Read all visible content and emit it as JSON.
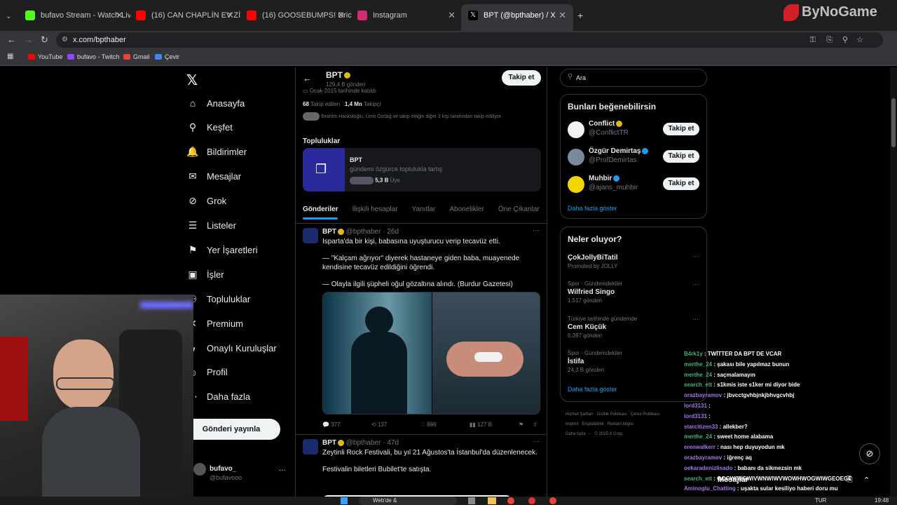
{
  "browser": {
    "tabs": [
      {
        "label": "bufavo Stream - Watch Live on",
        "color": "#53fc18"
      },
      {
        "label": "(16) CAN CHAPLİN EV ZİYARETİ",
        "color": "#ff0000"
      },
      {
        "label": "(16) GOOSEBUMPS! Dricus Du",
        "color": "#ff0000"
      },
      {
        "label": "Instagram",
        "color": "#d62976"
      },
      {
        "label": "BPT (@bpthaber) / X",
        "color": "#ffffff"
      }
    ],
    "url": "x.com/bpthaber",
    "bookmarks": [
      {
        "label": "YouTube",
        "color": "#ff0000"
      },
      {
        "label": "bufavo - Twitch",
        "color": "#9146ff"
      },
      {
        "label": "Gmail",
        "color": "#ea4335"
      },
      {
        "label": "Çevir",
        "color": "#4285f4"
      }
    ],
    "watermark": "ByNoGame"
  },
  "nav": {
    "items": [
      {
        "label": "Anasayfa",
        "icon": "home-icon",
        "glyph": "⌂"
      },
      {
        "label": "Keşfet",
        "icon": "search-icon",
        "glyph": "⚲"
      },
      {
        "label": "Bildirimler",
        "icon": "bell-icon",
        "glyph": "🔔"
      },
      {
        "label": "Mesajlar",
        "icon": "mail-icon",
        "glyph": "✉"
      },
      {
        "label": "Grok",
        "icon": "grok-icon",
        "glyph": "⊘"
      },
      {
        "label": "Listeler",
        "icon": "list-icon",
        "glyph": "☰"
      },
      {
        "label": "Yer İşaretleri",
        "icon": "bookmark-icon",
        "glyph": "⚑"
      },
      {
        "label": "İşler",
        "icon": "briefcase-icon",
        "glyph": "▣"
      },
      {
        "label": "Topluluklar",
        "icon": "people-icon",
        "glyph": "⚇"
      },
      {
        "label": "Premium",
        "icon": "x-logo-icon",
        "glyph": "✕"
      },
      {
        "label": "Onaylı Kuruluşlar",
        "icon": "lightning-icon",
        "glyph": "ϟ"
      },
      {
        "label": "Profil",
        "icon": "person-icon",
        "glyph": "☺"
      },
      {
        "label": "Daha fazla",
        "icon": "more-circle-icon",
        "glyph": "⋯"
      }
    ],
    "post_button": "Gönderi yayınla",
    "account_name": "bufavo_",
    "account_handle": "@bufavooo"
  },
  "profile": {
    "name": "BPT",
    "post_count": "129,4 B gönderi",
    "follow_label": "Takip et",
    "joined": "Ocak 2015 tarihinde katıldı",
    "following_count": "68",
    "following_label": "Takip edilen",
    "followers_count": "1,4 Mn",
    "followers_label": "Takipçi",
    "followed_by": "İbrahim Haskoloğlu, Ümit Özdağ ve takip ettiğin diğer 3 kişi tarafından takip ediliyor",
    "communities_title": "Topluluklar",
    "community": {
      "name": "BPT",
      "desc": "gündemi özgürce toplulukla tartış",
      "members": "5,3 B",
      "members_label": "Üye"
    },
    "tabs": [
      "Gönderiler",
      "İlişkili hesaplar",
      "Yanıtlar",
      "Abonelikler",
      "Öne Çıkanlar",
      "M"
    ]
  },
  "tweets": [
    {
      "name": "BPT",
      "handle": "@bpthaber",
      "time": "26d",
      "lines": [
        "Isparta'da bir kişi, babasına uyuşturucu verip tecavüz etti.",
        "— \"Kalçam ağrıyor\" diyerek hastaneye giden baba, muayenede kendisine tecavüz edildiğini öğrendi.",
        "— Olayla ilgili şüpheli oğul gözaltına alındı. (Burdur Gazetesi)"
      ],
      "replies": "377",
      "retweets": "137",
      "likes": "886",
      "views": "127 B"
    },
    {
      "name": "BPT",
      "handle": "@bpthaber",
      "time": "47d",
      "lines": [
        "Zeytinli Rock Festivali, bu yıl 21 Ağustos'ta İstanbul'da düzenlenecek.",
        "Festivalin biletleri Bubilet'te satışta."
      ]
    }
  ],
  "right": {
    "search_placeholder": "Ara",
    "suggest_title": "Bunları beğenebilirsin",
    "suggestions": [
      {
        "name": "Conflict",
        "handle": "@ConflictTR",
        "color": "#f2f2f2"
      },
      {
        "name": "Özgür Demirtaş",
        "handle": "@ProfDemirtas",
        "color": "#7a8a9a"
      },
      {
        "name": "Muhbir",
        "handle": "@ajans_muhbir",
        "color": "#f2d600"
      }
    ],
    "follow_label": "Takip et",
    "show_more": "Daha fazla göster",
    "trends_title": "Neler oluyor?",
    "trends": [
      {
        "context": "",
        "name": "ÇokJollyBiTatil",
        "meta": "Promoted by JOLLY"
      },
      {
        "context": "Spor · Gündemdekiler",
        "name": "Wilfried Singo",
        "meta": "1.517 gönderi"
      },
      {
        "context": "Türkiye tarihinde gündemde",
        "name": "Cem Küçük",
        "meta": "6.397 gönderi"
      },
      {
        "context": "Spor · Gündemdekiler",
        "name": "İstifa",
        "meta": "24,3 B gönderi"
      }
    ],
    "footer": [
      "Hizmet Şartları",
      "Gizlilik Politikası",
      "Çerez Politikası",
      "Imprint",
      "Erişilebilirlik",
      "Reklam bilgisi",
      "Daha fazla ···",
      "© 2025 X Corp."
    ],
    "messages_label": "Mesajlar"
  },
  "chat": [
    {
      "user": "B4rk1y",
      "msg": "TWİTTER DA BPT DE VCAR"
    },
    {
      "user": "merthe_24",
      "msg": "şakası bile yapılmaz bunun"
    },
    {
      "user": "merthe_24",
      "msg": "saçmalamayın"
    },
    {
      "user": "search_ett",
      "msg": "s1kmis iste s1ker mi diyor bide"
    },
    {
      "user": "orazbayramov",
      "msg": "jbvcctgvhbjnkjbhvgcvhbj"
    },
    {
      "user": "lord3131",
      "msg": ""
    },
    {
      "user": "lord3131",
      "msg": ""
    },
    {
      "user": "starcitizen33",
      "msg": "allekber?"
    },
    {
      "user": "merthe_24",
      "msg": "sweet home alabama"
    },
    {
      "user": "erenwalkerr",
      "msg": "nası hep duyuyodun mk"
    },
    {
      "user": "orazbayramov",
      "msg": "iğrenç aq"
    },
    {
      "user": "oekaradenizlisado",
      "msg": "babanı da sikmezsin mk"
    },
    {
      "user": "search_ett",
      "msg": "OOGWIWGWIVWNWIWVWOWHWOGWIWGEOEGE"
    },
    {
      "user": "Aminoglu_Chatting",
      "msg": "uşakta sular kesiliyo haberi doru mu"
    }
  ],
  "taskbar": {
    "search": "Web'de &",
    "lang": "TUR",
    "time": "19:48"
  }
}
